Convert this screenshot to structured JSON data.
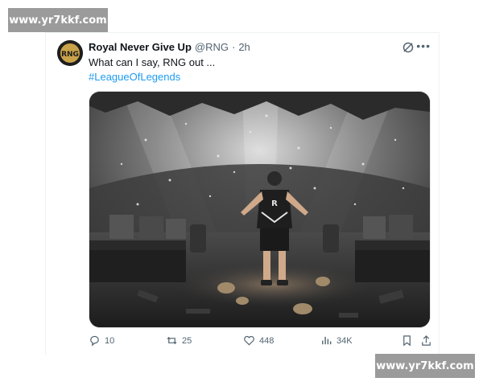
{
  "watermark": {
    "text": "www.yr7kkf.com"
  },
  "tweet": {
    "author_name": "Royal Never Give Up",
    "handle": "@RNG",
    "separator": "·",
    "time": "2h",
    "text": "What can I say, RNG out ...",
    "hashtag": "#LeagueOfLegends",
    "more": "•••",
    "avatar_logo": "RNG",
    "jersey_logo": "R",
    "stats": {
      "replies": "10",
      "reposts": "25",
      "likes": "448",
      "views": "34K"
    }
  },
  "icons": {
    "reply": "reply-icon",
    "repost": "repost-icon",
    "like": "heart-icon",
    "views": "views-icon",
    "bookmark": "bookmark-icon",
    "share": "share-icon",
    "grok": "grok-icon"
  },
  "colors": {
    "link": "#1d9bf0",
    "secondary_text": "#536471",
    "watermark_bg": "#9b9b9b"
  }
}
